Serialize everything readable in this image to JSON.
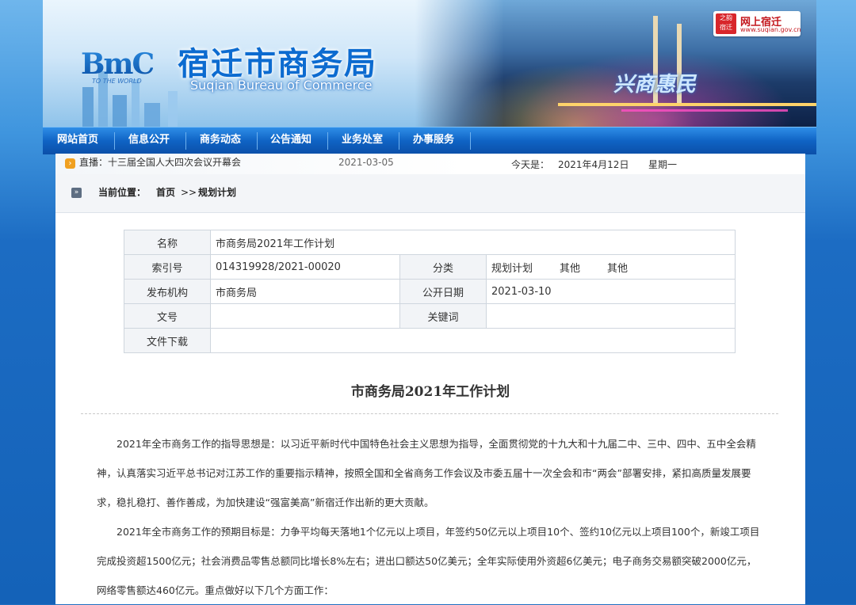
{
  "header": {
    "logo_text": "BmC",
    "logo_sub": "TO THE WORLD",
    "title_cn": "宿迁市商务局",
    "title_en": "Suqian Bureau of Commerce",
    "slogan": "兴商惠民",
    "badge": {
      "seal": "之韵 宿迁",
      "brand": "网上宿迁",
      "site": "www.suqian.gov.cn"
    }
  },
  "nav": {
    "items": [
      "网站首页",
      "信息公开",
      "商务动态",
      "公告通知",
      "业务处室",
      "办事服务"
    ]
  },
  "ticker": {
    "text": "直播：十三届全国人大四次会议开幕会",
    "date": "2021-03-05"
  },
  "today": {
    "label": "今天是：",
    "date": "2021年4月12日",
    "weekday": "星期一"
  },
  "breadcrumb": {
    "label": "当前位置：",
    "home": "首页",
    "sep": ">>",
    "current": "规划计划"
  },
  "meta": {
    "name_label": "名称",
    "name_value": "市商务局2021年工作计划",
    "index_label": "索引号",
    "index_value": "014319928/2021-00020",
    "category_label": "分类",
    "category_values": [
      "规划计划",
      "其他",
      "其他"
    ],
    "org_label": "发布机构",
    "org_value": "市商务局",
    "date_label": "公开日期",
    "date_value": "2021-03-10",
    "docno_label": "文号",
    "docno_value": "",
    "keyword_label": "关键词",
    "keyword_value": "",
    "download_label": "文件下载",
    "download_value": ""
  },
  "article": {
    "title": "市商务局2021年工作计划",
    "paragraphs": [
      "2021年全市商务工作的指导思想是：以习近平新时代中国特色社会主义思想为指导，全面贯彻党的十九大和十九届二中、三中、四中、五中全会精神，认真落实习近平总书记对江苏工作的重要指示精神，按照全国和全省商务工作会议及市委五届十一次全会和市“两会”部署安排，紧扣高质量发展要求，稳扎稳打、善作善成，为加快建设“强富美高”新宿迁作出新的更大贡献。",
      "2021年全市商务工作的预期目标是：力争平均每天落地1个亿元以上项目，年签约50亿元以上项目10个、签约10亿元以上项目100个，新竣工项目完成投资超1500亿元；社会消费品零售总额同比增长8%左右；进出口额达50亿美元；全年实际使用外资超6亿美元；电子商务交易额突破2000亿元，网络零售额达460亿元。重点做好以下几个方面工作："
    ]
  }
}
